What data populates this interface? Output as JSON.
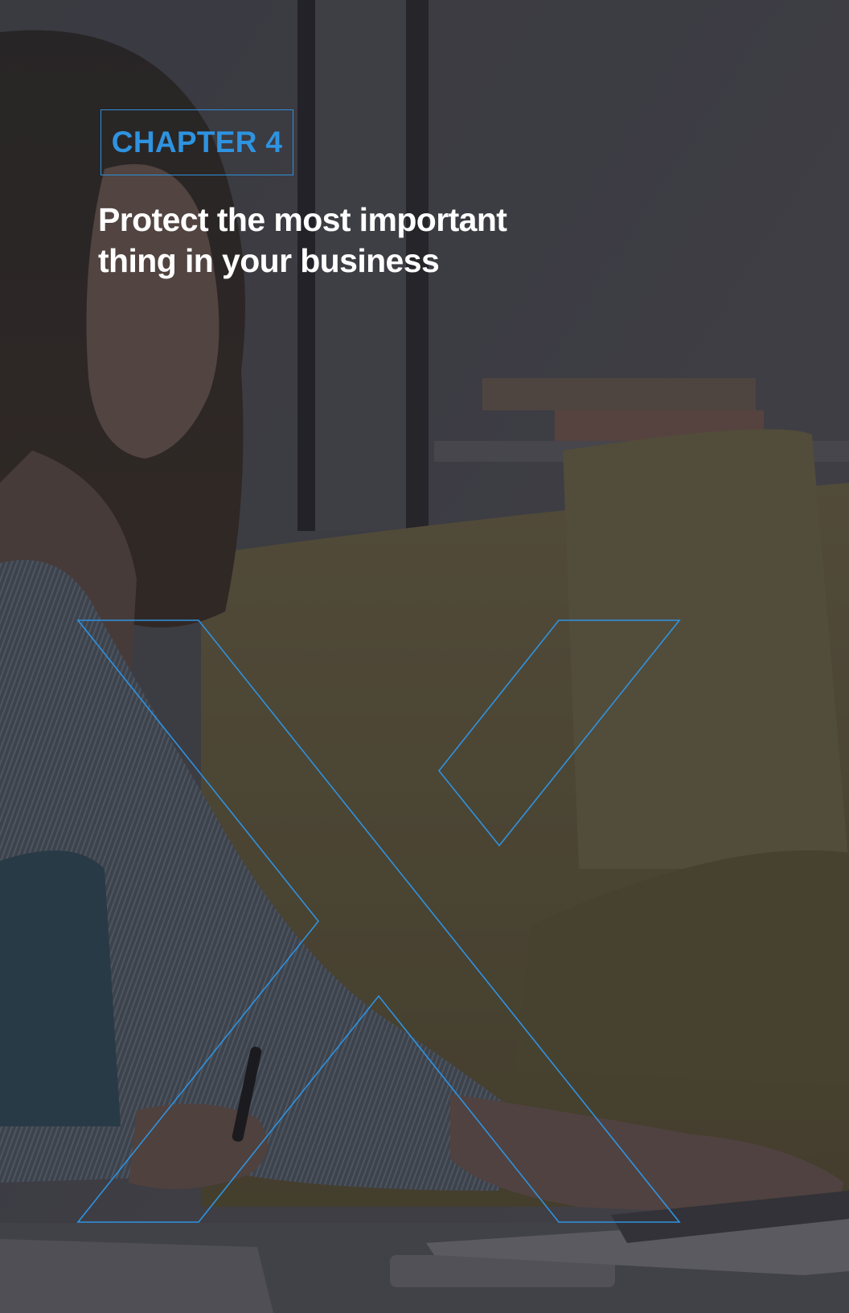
{
  "chapter": {
    "label": "CHAPTER 4"
  },
  "title": {
    "line1": "Protect the most important",
    "line2": "thing in your business"
  },
  "photo": {
    "description_icon": "person-with-laptop-photo"
  },
  "colors": {
    "accent": "#2e93e0",
    "title": "#ffffff",
    "overlay": "#1c1c22"
  }
}
